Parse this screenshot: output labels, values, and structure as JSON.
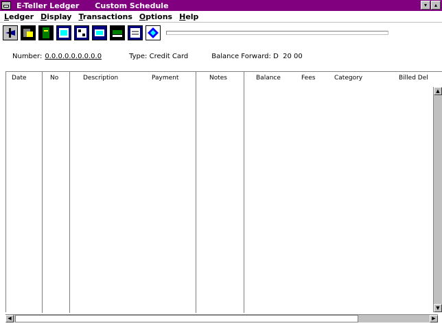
{
  "window": {
    "title": "E-Teller Ledger      Custom Schedule",
    "min_label": "▾",
    "max_label": "▴"
  },
  "menu": {
    "items": [
      {
        "first": "L",
        "rest": "edger"
      },
      {
        "first": "D",
        "rest": "isplay"
      },
      {
        "first": "T",
        "rest": "ransactions"
      },
      {
        "first": "O",
        "rest": "ptions"
      },
      {
        "first": "H",
        "rest": "elp"
      }
    ]
  },
  "toolbar": {
    "icons": [
      "plane-icon",
      "card-icon",
      "book-icon",
      "calendar-icon",
      "calculator-icon",
      "screen-icon",
      "printer-icon",
      "notepad-icon",
      "diamond-icon"
    ],
    "progress": 0.0
  },
  "info": {
    "number_label": "Number:",
    "number_value": "0.0.0.0.0.0.0.0.0",
    "type_text": "Type: Credit Card",
    "balance_text": "Balance Forward: D  20 00"
  },
  "columns": [
    "Date",
    "No",
    "Description",
    "Payment",
    "Notes",
    "Balance",
    "Fees",
    "Category",
    "Billed Del"
  ]
}
